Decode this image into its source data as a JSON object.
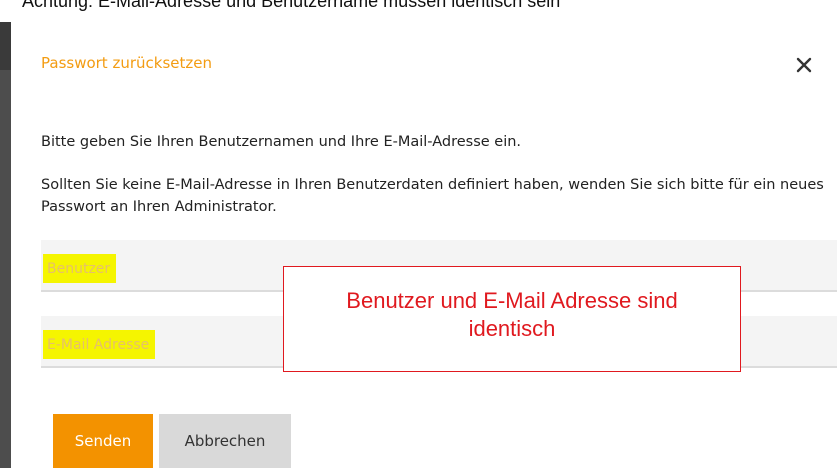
{
  "page_top_fragment": "Achtung: E-Mail-Adresse und Benutzername müssen identisch sein",
  "dialog": {
    "title": "Passwort zurücksetzen",
    "close_icon": "close-icon",
    "paragraph_1": "Bitte geben Sie Ihren Benutzernamen und Ihre E-Mail-Adresse ein.",
    "paragraph_2": "Sollten Sie keine E-Mail-Adresse in Ihren Benutzerdaten definiert haben, wenden Sie sich bitte für ein neues Passwort an Ihren Administrator.",
    "fields": {
      "username": {
        "placeholder": "Benutzer",
        "value": ""
      },
      "email": {
        "placeholder": "E-Mail Adresse",
        "value": ""
      }
    },
    "buttons": {
      "send": "Senden",
      "cancel": "Abbrechen"
    }
  },
  "annotation": {
    "line_1": "Benutzer und E-Mail Adresse sind",
    "line_2": "identisch"
  },
  "colors": {
    "accent": "#f39200",
    "title": "#f39c12",
    "highlight": "#f5f500",
    "annotation": "#e0191f"
  }
}
